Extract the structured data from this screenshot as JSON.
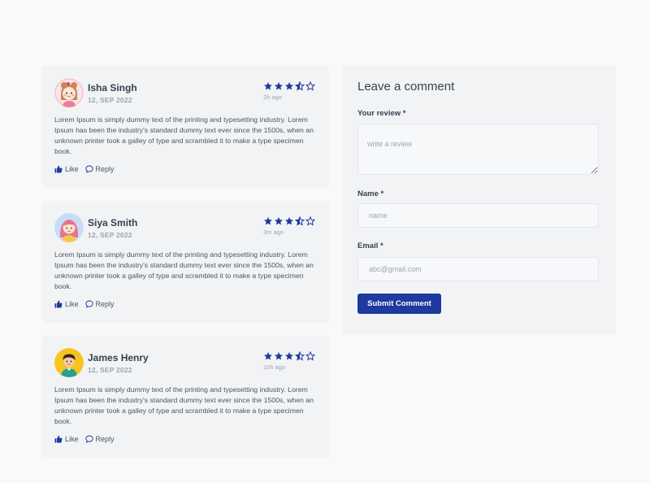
{
  "colors": {
    "accent": "#1e3a9e",
    "star": "#1e3a9e",
    "card_bg": "#f2f3f5",
    "page_bg": "#f8f9fb"
  },
  "reviews": [
    {
      "name": "Isha Singh",
      "date": "12, SEP 2022",
      "rating": 3.5,
      "time_ago": "2h ago",
      "text": "Lorem Ipsum is simply dummy text of the printing and typesetting industry. Lorem Ipsum has been the industry's standard dummy text ever since the 1500s, when an unknown printer took a galley of type and scrambled it to make a type specimen book.",
      "like_label": "Like",
      "reply_label": "Reply",
      "avatar_icon": "girl-avatar-icon"
    },
    {
      "name": "Siya Smith",
      "date": "12, SEP 2022",
      "rating": 3.5,
      "time_ago": "3m ago",
      "text": "Lorem Ipsum is simply dummy text of the printing and typesetting industry. Lorem Ipsum has been the industry's standard dummy text ever since the 1500s, when an unknown printer took a galley of type and scrambled it to make a type specimen book.",
      "like_label": "Like",
      "reply_label": "Reply",
      "avatar_icon": "woman-avatar-icon"
    },
    {
      "name": "James Henry",
      "date": "12, SEP 2022",
      "rating": 3.5,
      "time_ago": "10h ago",
      "text": "Lorem Ipsum is simply dummy text of the printing and typesetting industry. Lorem Ipsum has been the industry's standard dummy text ever since the 1500s, when an unknown printer took a galley of type and scrambled it to make a type specimen book.",
      "like_label": "Like",
      "reply_label": "Reply",
      "avatar_icon": "man-avatar-icon"
    }
  ],
  "form": {
    "title": "Leave a comment",
    "review_label": "Your review *",
    "review_placeholder": "write a review",
    "name_label": "Name *",
    "name_placeholder": "name",
    "email_label": "Email *",
    "email_placeholder": "abc@gmail.com",
    "submit_label": "Submit Comment"
  }
}
